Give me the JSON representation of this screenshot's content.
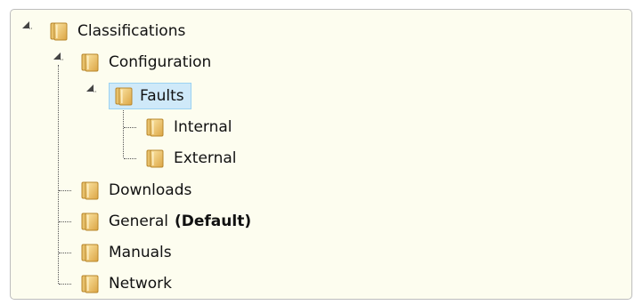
{
  "tree": {
    "root": {
      "label": "Classifications",
      "expanded": true
    },
    "configuration": {
      "label": "Configuration",
      "expanded": true
    },
    "faults": {
      "label": "Faults",
      "expanded": true,
      "selected": true
    },
    "internal": {
      "label": "Internal"
    },
    "external": {
      "label": "External"
    },
    "downloads": {
      "label": "Downloads"
    },
    "general": {
      "label": "General",
      "suffix": "(Default)"
    },
    "manuals": {
      "label": "Manuals"
    },
    "network": {
      "label": "Network"
    }
  },
  "icons": {
    "node": "folder-icon",
    "expander": "expanded-triangle-icon"
  },
  "colors": {
    "panel_bg": "#fdfdef",
    "selection_bg": "#cfe9f9",
    "selection_border": "#9bd2f2",
    "folder": "#e8b64c"
  }
}
